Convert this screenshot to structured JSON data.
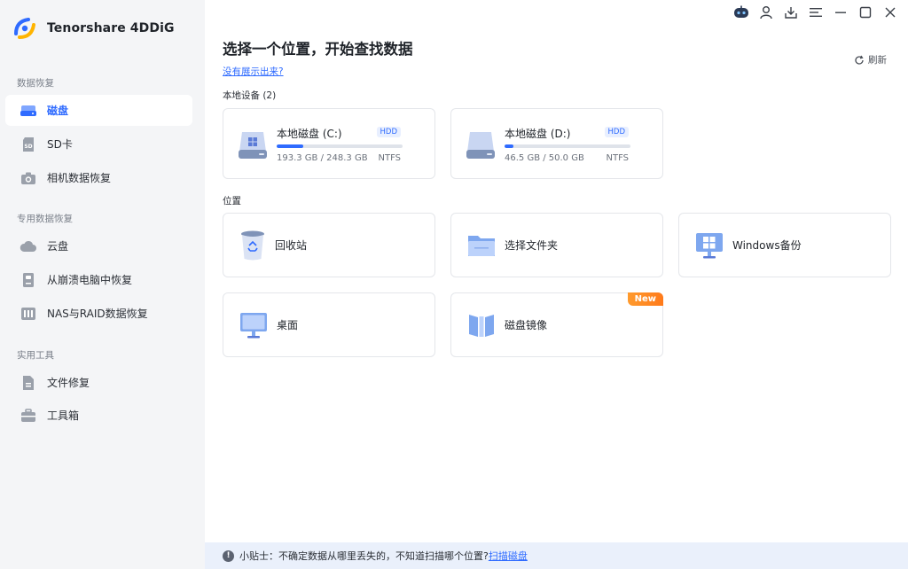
{
  "app": {
    "name": "Tenorshare 4DDiG"
  },
  "sidebar": {
    "sections": [
      {
        "label": "数据恢复"
      },
      {
        "label": "专用数据恢复"
      },
      {
        "label": "实用工具"
      }
    ],
    "items": [
      {
        "label": "磁盘",
        "icon": "disk-icon",
        "active": true
      },
      {
        "label": "SD卡",
        "icon": "sd-card-icon"
      },
      {
        "label": "相机数据恢复",
        "icon": "camera-icon"
      },
      {
        "label": "云盘",
        "icon": "cloud-icon"
      },
      {
        "label": "从崩溃电脑中恢复",
        "icon": "crashed-pc-icon"
      },
      {
        "label": "NAS与RAID数据恢复",
        "icon": "nas-raid-icon"
      },
      {
        "label": "文件修复",
        "icon": "file-repair-icon"
      },
      {
        "label": "工具箱",
        "icon": "toolbox-icon"
      }
    ]
  },
  "main": {
    "title": "选择一个位置，开始查找数据",
    "help_link": "没有展示出来?",
    "refresh_label": "刷新",
    "local_devices_label": "本地设备 (2)",
    "locations_label": "位置",
    "drives": [
      {
        "name": "本地磁盘 (C:)",
        "type": "HDD",
        "size": "193.3 GB / 248.3 GB",
        "fs": "NTFS",
        "used_fraction": 0.21
      },
      {
        "name": "本地磁盘 (D:)",
        "type": "HDD",
        "size": "46.5 GB / 50.0 GB",
        "fs": "NTFS",
        "used_fraction": 0.07
      }
    ],
    "locations": [
      {
        "label": "回收站",
        "icon": "recycle-bin-icon"
      },
      {
        "label": "选择文件夹",
        "icon": "folder-icon"
      },
      {
        "label": "Windows备份",
        "icon": "windows-backup-icon"
      },
      {
        "label": "桌面",
        "icon": "desktop-icon"
      },
      {
        "label": "磁盘镜像",
        "icon": "disk-image-icon",
        "badge": "New"
      }
    ]
  },
  "tip": {
    "icon": "!",
    "text": "小贴士：不确定数据从哪里丢失的，不知道扫描哪个位置?",
    "link": "扫描磁盘"
  },
  "colors": {
    "accent": "#2f6bff",
    "sidebar_bg": "#f4f5f7",
    "new_badge": "#ff8a24"
  }
}
